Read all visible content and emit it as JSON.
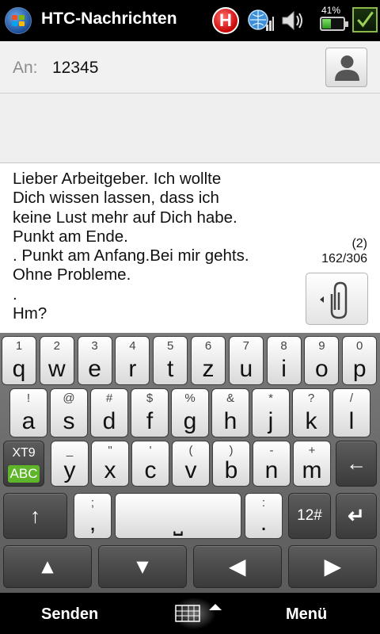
{
  "statusbar": {
    "title": "HTC-Nachrichten",
    "battery_percent": "41%",
    "h_label": "H",
    "icons": [
      "windows-start-icon",
      "h-data-icon",
      "signal-icon",
      "volume-icon",
      "battery-icon",
      "ok-check-icon"
    ]
  },
  "compose": {
    "to_label": "An:",
    "to_value": "12345",
    "body_lines": [
      "Lieber Arbeitgeber. Ich wollte",
      "Dich wissen lassen, dass ich",
      "keine Lust mehr auf Dich habe.",
      "Punkt am Ende.",
      ". Punkt am Anfang.Bei mir gehts.",
      "Ohne Probleme.",
      ".",
      "Hm?"
    ],
    "sms_parts": "(2)",
    "char_count": "162/306"
  },
  "keyboard": {
    "row1": [
      {
        "sub": "1",
        "main": "q"
      },
      {
        "sub": "2",
        "main": "w"
      },
      {
        "sub": "3",
        "main": "e"
      },
      {
        "sub": "4",
        "main": "r"
      },
      {
        "sub": "5",
        "main": "t"
      },
      {
        "sub": "6",
        "main": "z"
      },
      {
        "sub": "7",
        "main": "u"
      },
      {
        "sub": "8",
        "main": "i"
      },
      {
        "sub": "9",
        "main": "o"
      },
      {
        "sub": "0",
        "main": "p"
      }
    ],
    "row2": [
      {
        "sub": "!",
        "main": "a"
      },
      {
        "sub": "@",
        "main": "s"
      },
      {
        "sub": "#",
        "main": "d"
      },
      {
        "sub": "$",
        "main": "f"
      },
      {
        "sub": "%",
        "main": "g"
      },
      {
        "sub": "&",
        "main": "h"
      },
      {
        "sub": "*",
        "main": "j"
      },
      {
        "sub": "?",
        "main": "k"
      },
      {
        "sub": "/",
        "main": "l"
      }
    ],
    "row3": [
      {
        "sub": "_",
        "main": "y"
      },
      {
        "sub": "\"",
        "main": "x"
      },
      {
        "sub": "'",
        "main": "c"
      },
      {
        "sub": "(",
        "main": "v"
      },
      {
        "sub": ")",
        "main": "b"
      },
      {
        "sub": "-",
        "main": "n"
      },
      {
        "sub": "+",
        "main": "m"
      }
    ],
    "row4": [
      {
        "sub": ";",
        "main": ","
      },
      {
        "sub": "",
        "main": "⎵"
      },
      {
        "sub": ":",
        "main": "."
      }
    ],
    "xt9_label": "XT9",
    "abc_label": "ABC",
    "symbols_label": "12#",
    "accent_color": "#5fb52a"
  },
  "softkeys": {
    "left": "Senden",
    "right": "Menü"
  }
}
